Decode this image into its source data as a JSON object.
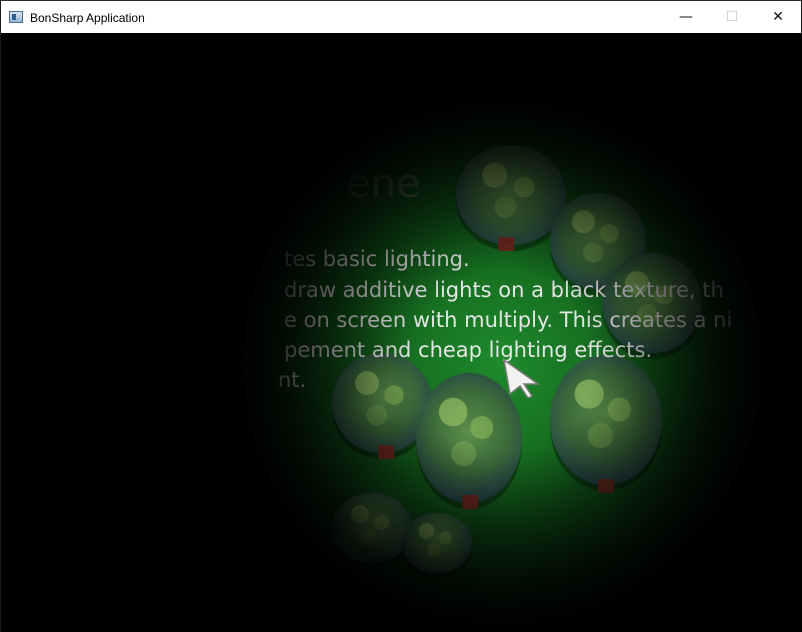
{
  "window": {
    "title": "BonSharp Application",
    "controls": {
      "minimize": "—",
      "maximize": "☐",
      "close": "✕"
    }
  },
  "scene": {
    "title_visible": "ene",
    "description_lines": [
      "tes basic lighting.",
      "draw additive lights on a black texture, th",
      "e on screen with multiply. This creates a ni",
      "pement and cheap lighting effects.",
      "nt."
    ]
  },
  "colors": {
    "grass": "#1f8a2c",
    "tree_foliage": "#5b8f4a",
    "tree_trunk": "#6e2a20",
    "background": "#000000"
  },
  "icons": {
    "app": "app-icon",
    "cursor": "pointer-arrow-icon"
  }
}
